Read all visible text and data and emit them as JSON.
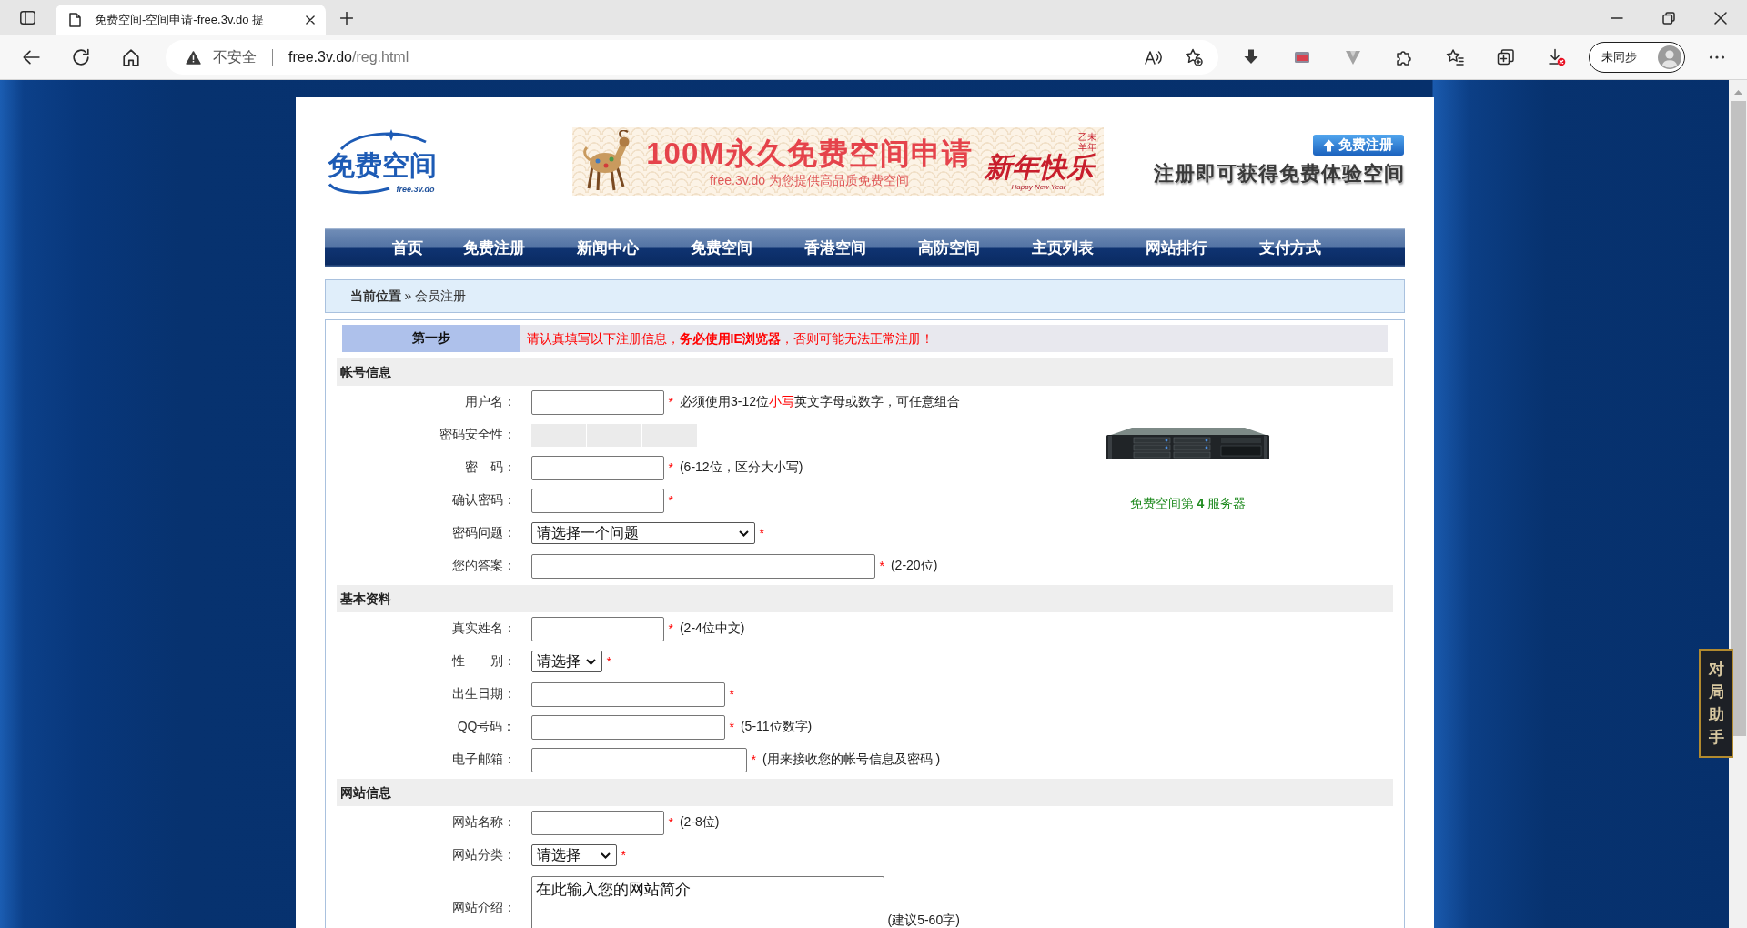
{
  "browser": {
    "tab": {
      "title": "免费空间-空间申请-free.3v.do 提"
    },
    "address_bar": {
      "security_label": "不安全",
      "host": "free.3v.do",
      "path": "/reg.html"
    },
    "profile": {
      "label": "未同步"
    }
  },
  "header": {
    "logo": {
      "title": "免费空间",
      "subtitle": "free.3v.do"
    },
    "banner": {
      "headline": "100M永久免费空间申请",
      "tagline": "free.3v.do 为您提供高品质免费空间",
      "year": "乙未羊年",
      "greeting": "新年快乐",
      "english_greeting": "Happy New Year"
    },
    "register_button": "免费注册",
    "promo": "注册即可获得免费体验空间"
  },
  "nav": [
    "首页",
    "免费注册",
    "新闻中心",
    "免费空间",
    "香港空间",
    "高防空间",
    "主页列表",
    "网站排行",
    "支付方式"
  ],
  "breadcrumb": "**当前位置** » 会员注册",
  "form": {
    "step": {
      "label": "第一步",
      "notice": "请认真填写以下注册信息，**务必使用IE浏览器**，否则可能无法正常注册！"
    },
    "sections": [
      {
        "title": "帐号信息",
        "fields": [
          {
            "kind": "text",
            "label": "用户名：",
            "required_mark": "*",
            "hint": [
              {
                "text": "必须使用3-12位",
                "highlight": false
              },
              {
                "text": "小写",
                "highlight": true
              },
              {
                "text": "英文字母或数字，可任意组合",
                "highlight": false
              }
            ]
          },
          {
            "kind": "strength",
            "label": "密码安全性：",
            "segments": [
              {
                "on": false
              },
              {
                "on": false
              },
              {
                "on": false
              }
            ]
          },
          {
            "kind": "text",
            "label": "密　码：",
            "required_mark": "*",
            "hint": [
              {
                "text": "(6-12位，区分大小写)",
                "highlight": false
              }
            ]
          },
          {
            "kind": "text",
            "label": "确认密码：",
            "required_mark": "*"
          },
          {
            "kind": "select",
            "label": "密码问题：",
            "value": "请选择一个问题",
            "required_mark": "*"
          },
          {
            "kind": "text",
            "label": "您的答案：",
            "required_mark": "*",
            "hint": [
              {
                "text": "(2-20位)",
                "highlight": false
              }
            ]
          }
        ],
        "aside": {
          "caption": "免费空间第 **4** 服务器"
        }
      },
      {
        "title": "基本资料",
        "fields": [
          {
            "kind": "text",
            "label": "真实姓名：",
            "required_mark": "*",
            "hint": [
              {
                "text": "(2-4位中文)",
                "highlight": false
              }
            ]
          },
          {
            "kind": "select",
            "label": "性　　别：",
            "value": "请选择",
            "required_mark": "*"
          },
          {
            "kind": "text",
            "label": "出生日期：",
            "required_mark": "*"
          },
          {
            "kind": "text",
            "label": "QQ号码：",
            "required_mark": "*",
            "hint": [
              {
                "text": "(5-11位数字)",
                "highlight": false
              }
            ]
          },
          {
            "kind": "text",
            "label": "电子邮箱：",
            "required_mark": "*",
            "hint": [
              {
                "text": "(用来接收您的帐号信息及密码 )",
                "highlight": false
              }
            ]
          }
        ]
      },
      {
        "title": "网站信息",
        "fields": [
          {
            "kind": "text",
            "label": "网站名称：",
            "required_mark": "*",
            "hint": [
              {
                "text": "(2-8位)",
                "highlight": false
              }
            ]
          },
          {
            "kind": "select",
            "label": "网站分类：",
            "value": "请选择",
            "required_mark": "*"
          },
          {
            "kind": "textarea",
            "label": "网站介绍：",
            "value": "在此输入您的网站简介",
            "hint": [
              {
                "text": "(建议5-60字)",
                "highlight": false
              }
            ]
          }
        ]
      }
    ]
  },
  "side_widget": {
    "label": "对局助手"
  }
}
